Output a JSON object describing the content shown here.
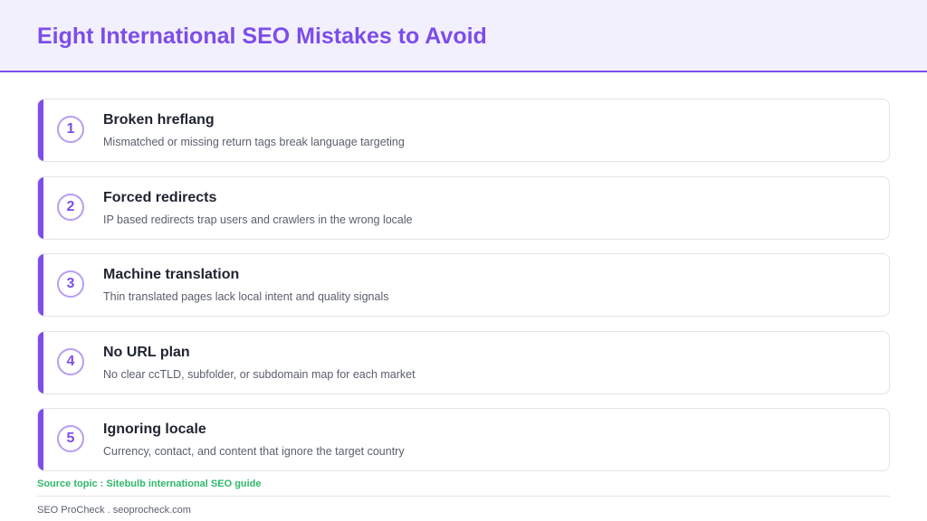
{
  "header": {
    "title": "Eight International SEO Mistakes to Avoid"
  },
  "colors": {
    "accent": "#7c4dea",
    "source": "#2fb86a",
    "header_bg": "#f3f0fd"
  },
  "items": [
    {
      "number": "1",
      "title": "Broken hreflang",
      "description": "Mismatched or missing return tags break language targeting"
    },
    {
      "number": "2",
      "title": "Forced redirects",
      "description": "IP based redirects trap users and crawlers in the wrong locale"
    },
    {
      "number": "3",
      "title": "Machine translation",
      "description": "Thin translated pages lack local intent and quality signals"
    },
    {
      "number": "4",
      "title": "No URL plan",
      "description": "No clear ccTLD, subfolder, or subdomain map for each market"
    },
    {
      "number": "5",
      "title": "Ignoring locale",
      "description": "Currency, contact, and content that ignore the target country"
    }
  ],
  "source": "Source topic : Sitebulb international SEO guide",
  "footer": "SEO ProCheck . seoprocheck.com"
}
